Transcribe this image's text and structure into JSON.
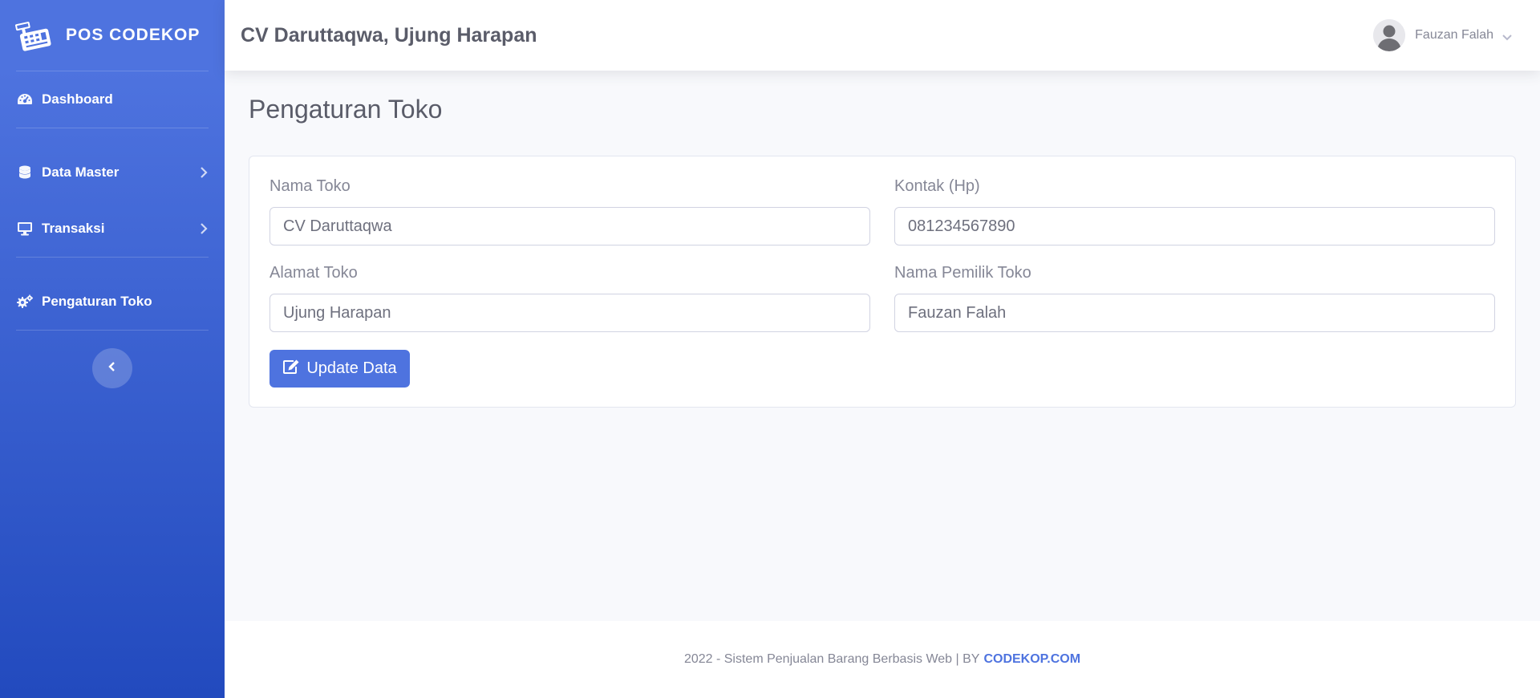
{
  "brand": {
    "name": "POS CODEKOP",
    "icon": "cash-register-icon"
  },
  "sidebar": {
    "items": [
      {
        "label": "Dashboard",
        "icon": "gauge-icon",
        "has_submenu": false
      },
      {
        "label": "Data Master",
        "icon": "database-icon",
        "has_submenu": true
      },
      {
        "label": "Transaksi",
        "icon": "desktop-icon",
        "has_submenu": true
      },
      {
        "label": "Pengaturan Toko",
        "icon": "cogs-icon",
        "has_submenu": false
      }
    ],
    "toggle_icon": "chevron-left-icon"
  },
  "topbar": {
    "store_title": "CV Daruttaqwa, Ujung Harapan",
    "user_name": "Fauzan Falah"
  },
  "page": {
    "title": "Pengaturan Toko"
  },
  "form": {
    "nama_toko": {
      "label": "Nama Toko",
      "value": "CV Daruttaqwa"
    },
    "kontak": {
      "label": "Kontak (Hp)",
      "value": "081234567890"
    },
    "alamat": {
      "label": "Alamat Toko",
      "value": "Ujung Harapan"
    },
    "pemilik": {
      "label": "Nama Pemilik Toko",
      "value": "Fauzan Falah"
    },
    "submit_label": "Update Data"
  },
  "footer": {
    "text": "2022 - Sistem Penjualan Barang Berbasis Web | BY",
    "link": "CODEKOP.COM"
  },
  "colors": {
    "primary": "#4e73df",
    "sidebar_gradient_end": "#224abe",
    "text_muted": "#858796",
    "heading": "#5a5c69"
  }
}
